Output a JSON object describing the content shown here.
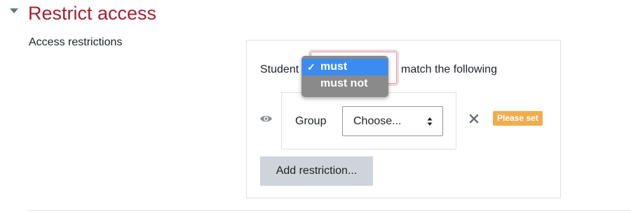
{
  "section": {
    "title": "Restrict access",
    "toggle_icon": "collapse-caret-icon"
  },
  "access": {
    "label": "Access restrictions",
    "students_prefix": "Student",
    "match_suffix": "match the following",
    "match_dropdown": {
      "selected": "must",
      "options": [
        "must",
        "must not"
      ]
    },
    "condition": {
      "type_label": "Group",
      "select_value": "Choose...",
      "badge": "Please set",
      "eye_icon": "eye-icon",
      "delete_icon": "close-icon"
    },
    "add_button": "Add restriction..."
  },
  "colors": {
    "section_title": "#a41f32",
    "badge": "#f0ad4e",
    "selected_option": "#3a8cf0",
    "button_bg": "#ced4da"
  }
}
